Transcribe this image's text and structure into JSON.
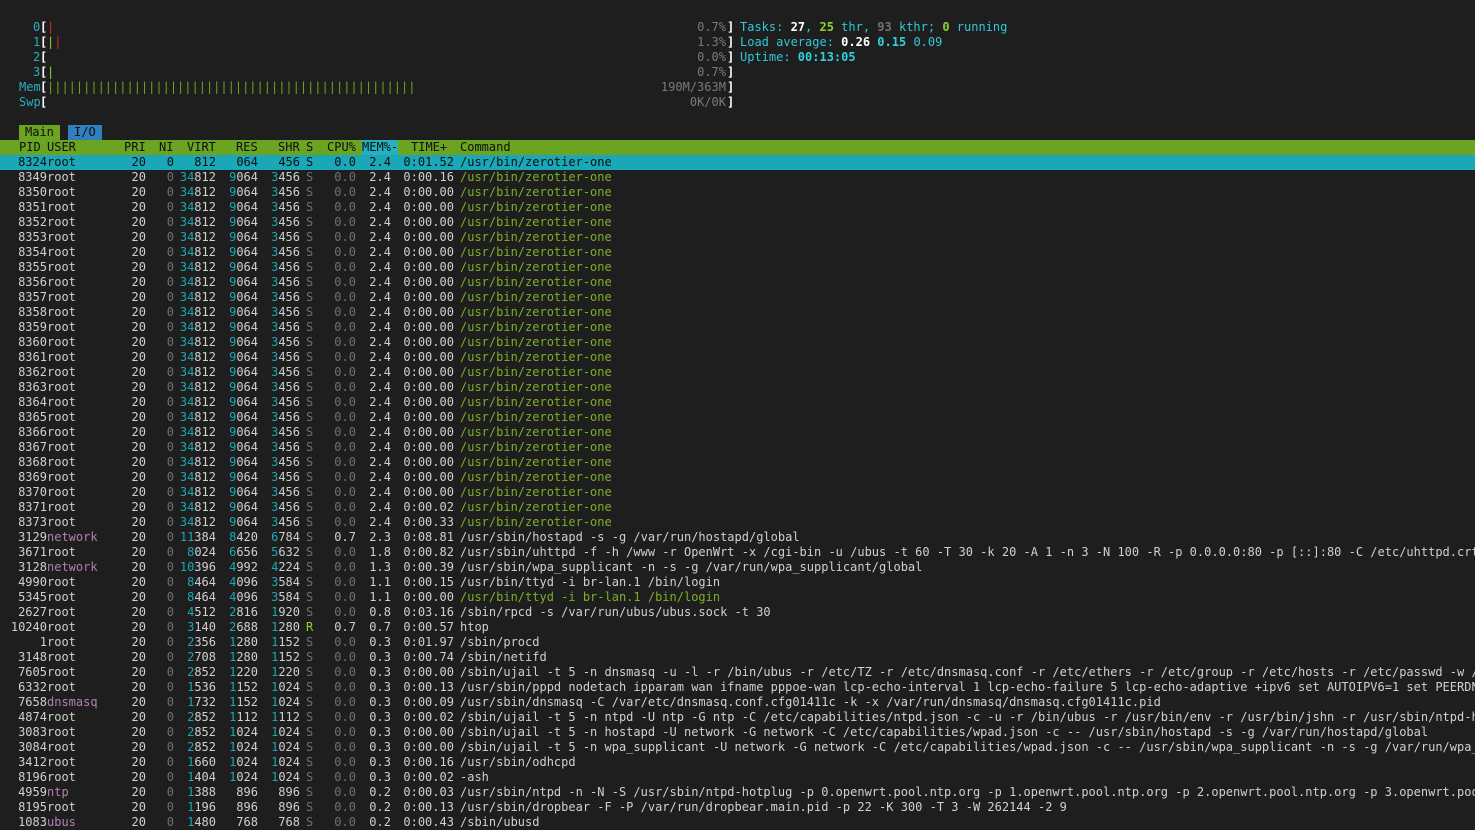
{
  "cpu_meters": [
    {
      "label": "0",
      "bar": [
        [
          "|",
          "r"
        ]
      ],
      "value": "0.7%"
    },
    {
      "label": "1",
      "bar": [
        [
          "|",
          "g"
        ],
        [
          "|",
          "r"
        ]
      ],
      "value": "1.3%"
    },
    {
      "label": "2",
      "bar": [],
      "value": "0.0%"
    },
    {
      "label": "3",
      "bar": [
        [
          "|",
          "g"
        ]
      ],
      "value": "0.7%"
    }
  ],
  "mem_meter": {
    "label": "Mem",
    "value": "190M/363M",
    "used_fraction": 0.523
  },
  "swp_meter": {
    "label": "Swp",
    "value": "0K/0K"
  },
  "stats": {
    "tasks_label": "Tasks: ",
    "tasks": "27",
    "thr": "25",
    "thr_label": " thr, ",
    "kthr": "93",
    "kthr_label": " kthr; ",
    "running": "0",
    "running_label": " running",
    "load_label": "Load average: ",
    "load1": "0.26",
    "load5": "0.15",
    "load15": "0.09",
    "uptime_label": "Uptime: ",
    "uptime": "00:13:05"
  },
  "tabs": [
    "Main",
    "I/O"
  ],
  "columns": [
    "PID",
    "USER",
    "PRI",
    "NI",
    "VIRT",
    "RES",
    "SHR",
    "S",
    "CPU%",
    "MEM%-",
    "TIME+",
    "Command"
  ],
  "processes": [
    [
      "8324",
      "root",
      "20",
      "0",
      "34812",
      "9064",
      "3456",
      "S",
      "0.0",
      "2.4",
      "0:01.52",
      "/usr/bin/zerotier-one",
      "sel"
    ],
    [
      "8349",
      "root",
      "20",
      "0",
      "34812",
      "9064",
      "3456",
      "S",
      "0.0",
      "2.4",
      "0:00.16",
      "/usr/bin/zerotier-one",
      "thr"
    ],
    [
      "8350",
      "root",
      "20",
      "0",
      "34812",
      "9064",
      "3456",
      "S",
      "0.0",
      "2.4",
      "0:00.00",
      "/usr/bin/zerotier-one",
      "thr"
    ],
    [
      "8351",
      "root",
      "20",
      "0",
      "34812",
      "9064",
      "3456",
      "S",
      "0.0",
      "2.4",
      "0:00.00",
      "/usr/bin/zerotier-one",
      "thr"
    ],
    [
      "8352",
      "root",
      "20",
      "0",
      "34812",
      "9064",
      "3456",
      "S",
      "0.0",
      "2.4",
      "0:00.00",
      "/usr/bin/zerotier-one",
      "thr"
    ],
    [
      "8353",
      "root",
      "20",
      "0",
      "34812",
      "9064",
      "3456",
      "S",
      "0.0",
      "2.4",
      "0:00.00",
      "/usr/bin/zerotier-one",
      "thr"
    ],
    [
      "8354",
      "root",
      "20",
      "0",
      "34812",
      "9064",
      "3456",
      "S",
      "0.0",
      "2.4",
      "0:00.00",
      "/usr/bin/zerotier-one",
      "thr"
    ],
    [
      "8355",
      "root",
      "20",
      "0",
      "34812",
      "9064",
      "3456",
      "S",
      "0.0",
      "2.4",
      "0:00.00",
      "/usr/bin/zerotier-one",
      "thr"
    ],
    [
      "8356",
      "root",
      "20",
      "0",
      "34812",
      "9064",
      "3456",
      "S",
      "0.0",
      "2.4",
      "0:00.00",
      "/usr/bin/zerotier-one",
      "thr"
    ],
    [
      "8357",
      "root",
      "20",
      "0",
      "34812",
      "9064",
      "3456",
      "S",
      "0.0",
      "2.4",
      "0:00.00",
      "/usr/bin/zerotier-one",
      "thr"
    ],
    [
      "8358",
      "root",
      "20",
      "0",
      "34812",
      "9064",
      "3456",
      "S",
      "0.0",
      "2.4",
      "0:00.00",
      "/usr/bin/zerotier-one",
      "thr"
    ],
    [
      "8359",
      "root",
      "20",
      "0",
      "34812",
      "9064",
      "3456",
      "S",
      "0.0",
      "2.4",
      "0:00.00",
      "/usr/bin/zerotier-one",
      "thr"
    ],
    [
      "8360",
      "root",
      "20",
      "0",
      "34812",
      "9064",
      "3456",
      "S",
      "0.0",
      "2.4",
      "0:00.00",
      "/usr/bin/zerotier-one",
      "thr"
    ],
    [
      "8361",
      "root",
      "20",
      "0",
      "34812",
      "9064",
      "3456",
      "S",
      "0.0",
      "2.4",
      "0:00.00",
      "/usr/bin/zerotier-one",
      "thr"
    ],
    [
      "8362",
      "root",
      "20",
      "0",
      "34812",
      "9064",
      "3456",
      "S",
      "0.0",
      "2.4",
      "0:00.00",
      "/usr/bin/zerotier-one",
      "thr"
    ],
    [
      "8363",
      "root",
      "20",
      "0",
      "34812",
      "9064",
      "3456",
      "S",
      "0.0",
      "2.4",
      "0:00.00",
      "/usr/bin/zerotier-one",
      "thr"
    ],
    [
      "8364",
      "root",
      "20",
      "0",
      "34812",
      "9064",
      "3456",
      "S",
      "0.0",
      "2.4",
      "0:00.00",
      "/usr/bin/zerotier-one",
      "thr"
    ],
    [
      "8365",
      "root",
      "20",
      "0",
      "34812",
      "9064",
      "3456",
      "S",
      "0.0",
      "2.4",
      "0:00.00",
      "/usr/bin/zerotier-one",
      "thr"
    ],
    [
      "8366",
      "root",
      "20",
      "0",
      "34812",
      "9064",
      "3456",
      "S",
      "0.0",
      "2.4",
      "0:00.00",
      "/usr/bin/zerotier-one",
      "thr"
    ],
    [
      "8367",
      "root",
      "20",
      "0",
      "34812",
      "9064",
      "3456",
      "S",
      "0.0",
      "2.4",
      "0:00.00",
      "/usr/bin/zerotier-one",
      "thr"
    ],
    [
      "8368",
      "root",
      "20",
      "0",
      "34812",
      "9064",
      "3456",
      "S",
      "0.0",
      "2.4",
      "0:00.00",
      "/usr/bin/zerotier-one",
      "thr"
    ],
    [
      "8369",
      "root",
      "20",
      "0",
      "34812",
      "9064",
      "3456",
      "S",
      "0.0",
      "2.4",
      "0:00.00",
      "/usr/bin/zerotier-one",
      "thr"
    ],
    [
      "8370",
      "root",
      "20",
      "0",
      "34812",
      "9064",
      "3456",
      "S",
      "0.0",
      "2.4",
      "0:00.00",
      "/usr/bin/zerotier-one",
      "thr"
    ],
    [
      "8371",
      "root",
      "20",
      "0",
      "34812",
      "9064",
      "3456",
      "S",
      "0.0",
      "2.4",
      "0:00.02",
      "/usr/bin/zerotier-one",
      "thr"
    ],
    [
      "8373",
      "root",
      "20",
      "0",
      "34812",
      "9064",
      "3456",
      "S",
      "0.0",
      "2.4",
      "0:00.33",
      "/usr/bin/zerotier-one",
      "thr"
    ],
    [
      "3129",
      "network",
      "20",
      "0",
      "11384",
      "8420",
      "6784",
      "S",
      "0.7",
      "2.3",
      "0:08.81",
      "/usr/sbin/hostapd -s -g /var/run/hostapd/global",
      ""
    ],
    [
      "3671",
      "root",
      "20",
      "0",
      "8024",
      "6656",
      "5632",
      "S",
      "0.0",
      "1.8",
      "0:00.82",
      "/usr/sbin/uhttpd -f -h /www -r OpenWrt -x /cgi-bin -u /ubus -t 60 -T 30 -k 20 -A 1 -n 3 -N 100 -R -p 0.0.0.0:80 -p [::]:80 -C /etc/uhttpd.crt -K",
      ""
    ],
    [
      "3128",
      "network",
      "20",
      "0",
      "10396",
      "4992",
      "4224",
      "S",
      "0.0",
      "1.3",
      "0:00.39",
      "/usr/sbin/wpa_supplicant -n -s -g /var/run/wpa_supplicant/global",
      ""
    ],
    [
      "4990",
      "root",
      "20",
      "0",
      "8464",
      "4096",
      "3584",
      "S",
      "0.0",
      "1.1",
      "0:00.15",
      "/usr/bin/ttyd -i br-lan.1 /bin/login",
      ""
    ],
    [
      "5345",
      "root",
      "20",
      "0",
      "8464",
      "4096",
      "3584",
      "S",
      "0.0",
      "1.1",
      "0:00.00",
      "/usr/bin/ttyd -i br-lan.1 /bin/login",
      "thr"
    ],
    [
      "2627",
      "root",
      "20",
      "0",
      "4512",
      "2816",
      "1920",
      "S",
      "0.0",
      "0.8",
      "0:03.16",
      "/sbin/rpcd -s /var/run/ubus/ubus.sock -t 30",
      ""
    ],
    [
      "10240",
      "root",
      "20",
      "0",
      "3140",
      "2688",
      "1280",
      "R",
      "0.7",
      "0.7",
      "0:00.57",
      "htop",
      ""
    ],
    [
      "1",
      "root",
      "20",
      "0",
      "2356",
      "1280",
      "1152",
      "S",
      "0.0",
      "0.3",
      "0:01.97",
      "/sbin/procd",
      ""
    ],
    [
      "3148",
      "root",
      "20",
      "0",
      "2708",
      "1280",
      "1152",
      "S",
      "0.0",
      "0.3",
      "0:00.74",
      "/sbin/netifd",
      ""
    ],
    [
      "7605",
      "root",
      "20",
      "0",
      "2852",
      "1220",
      "1220",
      "S",
      "0.0",
      "0.3",
      "0:00.00",
      "/sbin/ujail -t 5 -n dnsmasq -u -l -r /bin/ubus -r /etc/TZ -r /etc/dnsmasq.conf -r /etc/ethers -r /etc/group -r /etc/hosts -r /etc/passwd -w /tmp/",
      ""
    ],
    [
      "6332",
      "root",
      "20",
      "0",
      "1536",
      "1152",
      "1024",
      "S",
      "0.0",
      "0.3",
      "0:00.13",
      "/usr/sbin/pppd nodetach ipparam wan ifname pppoe-wan lcp-echo-interval 1 lcp-echo-failure 5 lcp-echo-adaptive +ipv6 set AUTOIPV6=1 set PEERDNS=0",
      ""
    ],
    [
      "7658",
      "dnsmasq",
      "20",
      "0",
      "1732",
      "1152",
      "1024",
      "S",
      "0.0",
      "0.3",
      "0:00.09",
      "/usr/sbin/dnsmasq -C /var/etc/dnsmasq.conf.cfg01411c -k -x /var/run/dnsmasq/dnsmasq.cfg01411c.pid",
      ""
    ],
    [
      "4874",
      "root",
      "20",
      "0",
      "2852",
      "1112",
      "1112",
      "S",
      "0.0",
      "0.3",
      "0:00.02",
      "/sbin/ujail -t 5 -n ntpd -U ntp -G ntp -C /etc/capabilities/ntpd.json -c -u -r /bin/ubus -r /usr/bin/env -r /usr/bin/jshn -r /usr/sbin/ntpd-hotpl",
      ""
    ],
    [
      "3083",
      "root",
      "20",
      "0",
      "2852",
      "1024",
      "1024",
      "S",
      "0.0",
      "0.3",
      "0:00.00",
      "/sbin/ujail -t 5 -n hostapd -U network -G network -C /etc/capabilities/wpad.json -c -- /usr/sbin/hostapd -s -g /var/run/hostapd/global",
      ""
    ],
    [
      "3084",
      "root",
      "20",
      "0",
      "2852",
      "1024",
      "1024",
      "S",
      "0.0",
      "0.3",
      "0:00.00",
      "/sbin/ujail -t 5 -n wpa_supplicant -U network -G network -C /etc/capabilities/wpad.json -c -- /usr/sbin/wpa_supplicant -n -s -g /var/run/wpa_supp",
      ""
    ],
    [
      "3412",
      "root",
      "20",
      "0",
      "1660",
      "1024",
      "1024",
      "S",
      "0.0",
      "0.3",
      "0:00.16",
      "/usr/sbin/odhcpd",
      ""
    ],
    [
      "8196",
      "root",
      "20",
      "0",
      "1404",
      "1024",
      "1024",
      "S",
      "0.0",
      "0.3",
      "0:00.02",
      "-ash",
      ""
    ],
    [
      "4959",
      "ntp",
      "20",
      "0",
      "1388",
      "896",
      "896",
      "S",
      "0.0",
      "0.2",
      "0:00.03",
      "/usr/sbin/ntpd -n -N -S /usr/sbin/ntpd-hotplug -p 0.openwrt.pool.ntp.org -p 1.openwrt.pool.ntp.org -p 2.openwrt.pool.ntp.org -p 3.openwrt.pool.nt",
      ""
    ],
    [
      "8195",
      "root",
      "20",
      "0",
      "1196",
      "896",
      "896",
      "S",
      "0.0",
      "0.2",
      "0:00.13",
      "/usr/sbin/dropbear -F -P /var/run/dropbear.main.pid -p 22 -K 300 -T 3 -W 262144 -2 9",
      ""
    ],
    [
      "1083",
      "ubus",
      "20",
      "0",
      "1480",
      "768",
      "768",
      "S",
      "0.0",
      "0.2",
      "0:00.43",
      "/sbin/ubusd",
      ""
    ]
  ]
}
